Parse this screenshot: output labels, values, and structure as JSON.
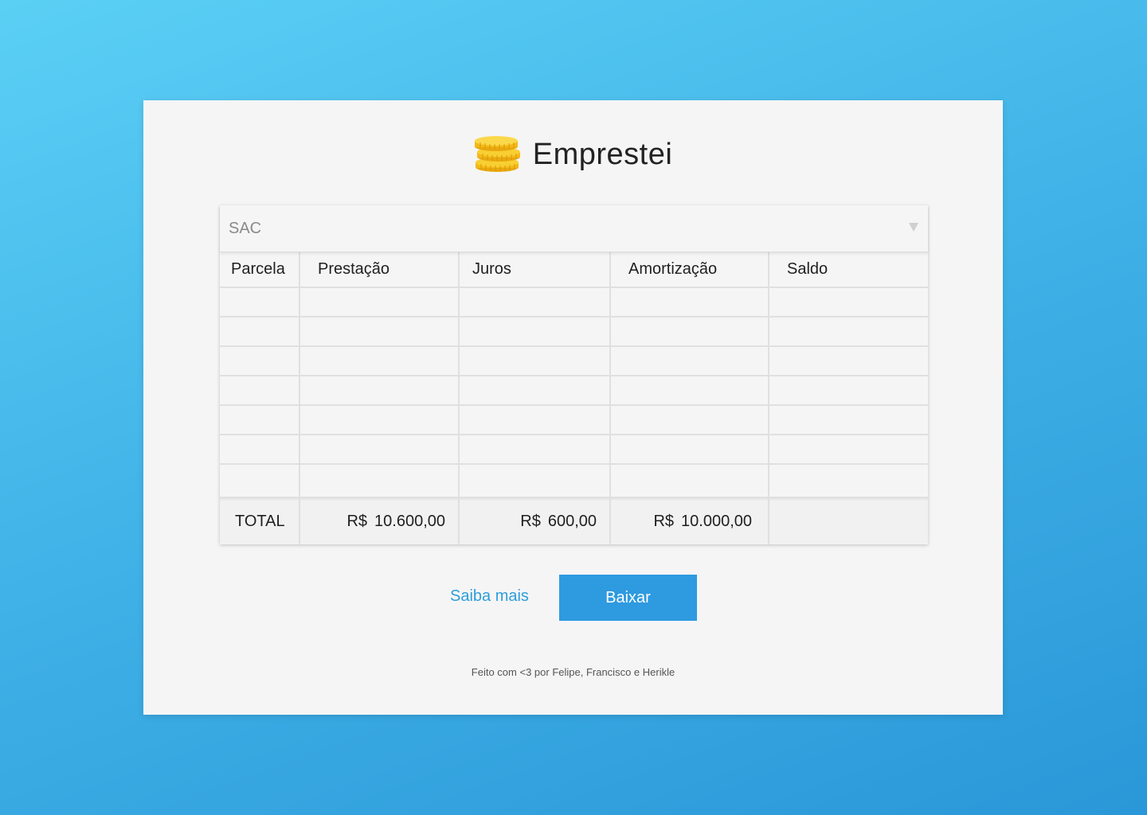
{
  "app": {
    "title": "Emprestei",
    "logo_icon": "coins-stack-icon"
  },
  "system_select": {
    "value": "SAC"
  },
  "table": {
    "headers": [
      "Parcela",
      "Prestação",
      "Juros",
      "Amortização",
      "Saldo"
    ],
    "rows": [
      [
        "",
        "",
        "",
        "",
        ""
      ],
      [
        "",
        "",
        "",
        "",
        ""
      ],
      [
        "",
        "",
        "",
        "",
        ""
      ],
      [
        "",
        "",
        "",
        "",
        ""
      ],
      [
        "",
        "",
        "",
        "",
        ""
      ],
      [
        "",
        "",
        "",
        "",
        ""
      ],
      [
        "",
        "",
        "",
        "",
        ""
      ]
    ],
    "total": {
      "label": "TOTAL",
      "currency": "R$",
      "prestacao": "10.600,00",
      "juros": "600,00",
      "amortizacao": "10.000,00",
      "saldo": ""
    }
  },
  "actions": {
    "learn_more": "Saiba mais",
    "download": "Baixar"
  },
  "footer": {
    "text": "Feito com <3 por Felipe, Francisco e Herikle"
  },
  "colors": {
    "accent": "#2e9ae0",
    "link": "#2e9edc",
    "coin": "#f6c21c"
  }
}
